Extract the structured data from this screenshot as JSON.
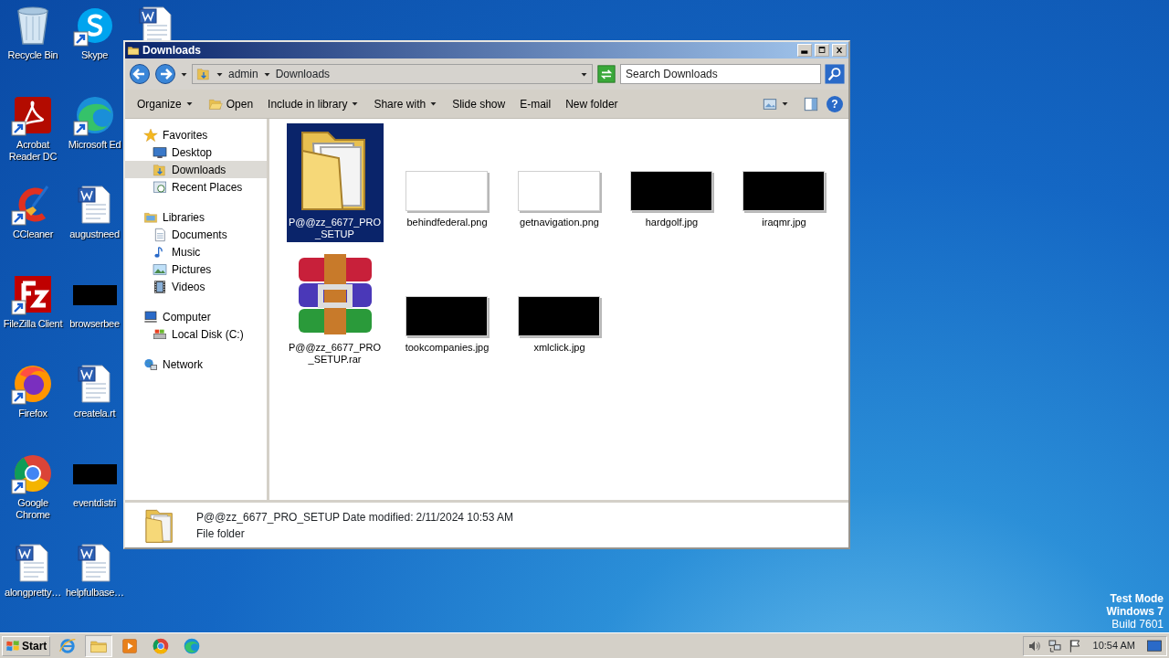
{
  "desktop": {
    "icons": [
      {
        "label": "Recycle Bin",
        "kind": "recycle",
        "shortcut": false
      },
      {
        "label": "Acrobat Reader DC",
        "kind": "acrobat",
        "shortcut": true
      },
      {
        "label": "CCleaner",
        "kind": "ccleaner",
        "shortcut": true
      },
      {
        "label": "FileZilla Client",
        "kind": "filezilla",
        "shortcut": true
      },
      {
        "label": "Firefox",
        "kind": "firefox",
        "shortcut": true
      },
      {
        "label": "Google Chrome",
        "kind": "chrome",
        "shortcut": true
      },
      {
        "label": "alongpretty…",
        "kind": "word",
        "shortcut": false
      },
      {
        "label": "Skype",
        "kind": "skype",
        "shortcut": true
      },
      {
        "label": "Microsoft Ed",
        "kind": "edge",
        "shortcut": true
      },
      {
        "label": "augustneed",
        "kind": "word",
        "shortcut": false
      },
      {
        "label": "browserbee",
        "kind": "black",
        "shortcut": false
      },
      {
        "label": "createla.rt",
        "kind": "word",
        "shortcut": false
      },
      {
        "label": "eventdistri",
        "kind": "black",
        "shortcut": false
      },
      {
        "label": "helpfulbase…",
        "kind": "word",
        "shortcut": false
      },
      {
        "kind": "word",
        "shortcut": false
      }
    ]
  },
  "window": {
    "title": "Downloads",
    "address": {
      "crumbs": [
        "admin",
        "Downloads"
      ]
    },
    "search": {
      "placeholder": "Search Downloads"
    },
    "toolbar": [
      {
        "label": "Organize",
        "dropdown": true
      },
      {
        "label": "Open",
        "dropdown": false,
        "kind": "open"
      },
      {
        "label": "Include in library",
        "dropdown": true
      },
      {
        "label": "Share with",
        "dropdown": true
      },
      {
        "label": "Slide show",
        "dropdown": false
      },
      {
        "label": "E-mail",
        "dropdown": false
      },
      {
        "label": "New folder",
        "dropdown": false
      }
    ],
    "help_label": "?",
    "sidebar": [
      {
        "label": "Favorites",
        "kind": "star",
        "selected": false,
        "children": [
          {
            "label": "Desktop",
            "kind": "desktop",
            "selected": false
          },
          {
            "label": "Downloads",
            "kind": "downloads",
            "selected": true
          },
          {
            "label": "Recent Places",
            "kind": "recent",
            "selected": false
          }
        ]
      },
      {
        "label": "Libraries",
        "kind": "libraries",
        "selected": false,
        "children": [
          {
            "label": "Documents",
            "kind": "documents",
            "selected": false
          },
          {
            "label": "Music",
            "kind": "music",
            "selected": false
          },
          {
            "label": "Pictures",
            "kind": "pictures",
            "selected": false
          },
          {
            "label": "Videos",
            "kind": "videos",
            "selected": false
          }
        ]
      },
      {
        "label": "Computer",
        "kind": "computer",
        "selected": false,
        "children": [
          {
            "label": "Local Disk (C:)",
            "kind": "disk",
            "selected": false
          }
        ]
      },
      {
        "label": "Network",
        "kind": "network",
        "selected": false
      }
    ],
    "files": [
      {
        "name": "P@@zz_6677_PRO_SETUP",
        "kind": "folder",
        "selected": true
      },
      {
        "name": "behindfederal.png",
        "kind": "light_image",
        "selected": false
      },
      {
        "name": "getnavigation.png",
        "kind": "light_image",
        "selected": false
      },
      {
        "name": "hardgolf.jpg",
        "kind": "dark_image",
        "selected": false
      },
      {
        "name": "iraqmr.jpg",
        "kind": "dark_image",
        "selected": false
      },
      {
        "name": "P@@zz_6677_PRO_SETUP.rar",
        "kind": "archive",
        "selected": false
      },
      {
        "name": "tookcompanies.jpg",
        "kind": "dark_image",
        "selected": false
      },
      {
        "name": "xmlclick.jpg",
        "kind": "dark_image",
        "selected": false
      }
    ],
    "details": {
      "name": "P@@zz_6677_PRO_SETUP",
      "date_label": "Date modified:",
      "date": "2/11/2024 10:53 AM",
      "type": "File folder"
    }
  },
  "taskbar": {
    "start": "Start",
    "apps": [
      {
        "kind": "ie",
        "active": false
      },
      {
        "kind": "explorer",
        "active": true
      },
      {
        "kind": "media",
        "active": false
      },
      {
        "kind": "chrome",
        "active": false
      },
      {
        "kind": "edge",
        "active": false
      }
    ],
    "clock": "10:54 AM"
  },
  "system_notice": [
    "Test Mode",
    "Windows 7",
    "Build 7601"
  ]
}
